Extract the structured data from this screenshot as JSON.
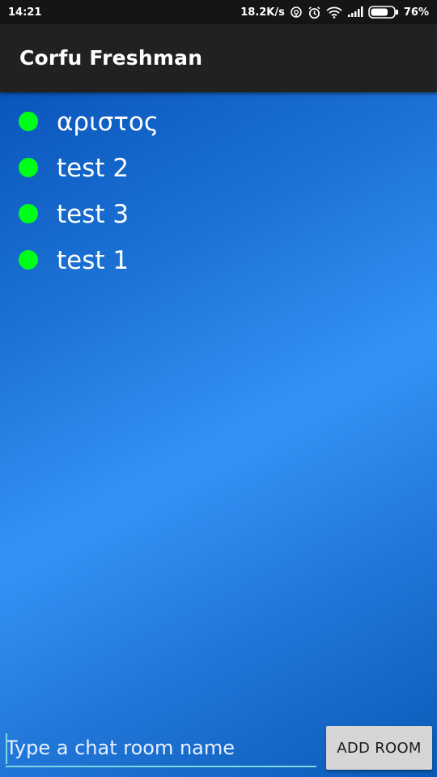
{
  "status_bar": {
    "time": "14:21",
    "network_speed": "18.2K/s",
    "battery_percent": "76%",
    "battery_level": 0.76,
    "icons": [
      "hotspot-icon",
      "alarm-icon",
      "wifi-icon",
      "signal-icon",
      "battery-icon"
    ]
  },
  "app_bar": {
    "title": "Corfu Freshman"
  },
  "rooms": [
    {
      "name": "αριστος",
      "status": "online"
    },
    {
      "name": "test 2",
      "status": "online"
    },
    {
      "name": "test 3",
      "status": "online"
    },
    {
      "name": "test 1",
      "status": "online"
    }
  ],
  "composer": {
    "placeholder": "Type a chat room name",
    "value": "",
    "add_button_label": "ADD ROOM"
  },
  "colors": {
    "app_bar": "#212121",
    "status_bar": "#151515",
    "online_dot": "#00ff18",
    "input_underline": "#7fd8e0",
    "button": "#d6d6d6"
  }
}
